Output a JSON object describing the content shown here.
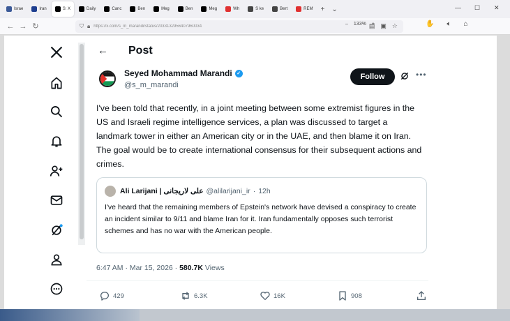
{
  "browser": {
    "tabs": [
      {
        "label": "Israe",
        "color": "#3b5998"
      },
      {
        "label": "Iran",
        "color": "#1d3d8f"
      },
      {
        "label": "S: X",
        "color": "#000000",
        "active": true
      },
      {
        "label": "Daily",
        "color": "#000000"
      },
      {
        "label": "Canc",
        "color": "#000000"
      },
      {
        "label": "Ben",
        "color": "#000000"
      },
      {
        "label": "Meg",
        "color": "#000000"
      },
      {
        "label": "Ben",
        "color": "#000000"
      },
      {
        "label": "Meg",
        "color": "#000000"
      },
      {
        "label": "Wh",
        "color": "#e03131"
      },
      {
        "label": "S ke",
        "color": "#444444"
      },
      {
        "label": "Bert",
        "color": "#444444"
      },
      {
        "label": "REM",
        "color": "#e03131"
      }
    ],
    "new_tab": "+",
    "url": "https://x.com/s_m_marandi/status/2033132956407960034",
    "zoom": "133%"
  },
  "sidebar": {
    "items": [
      "x-logo-icon",
      "home-icon",
      "search-icon",
      "notifications-icon",
      "follow-icon",
      "messages-icon",
      "grok-icon",
      "profile-icon",
      "more-icon"
    ]
  },
  "post": {
    "header_title": "Post",
    "author_name": "Seyed Mohammad Marandi",
    "author_handle": "@s_m_marandi",
    "follow_label": "Follow",
    "text": "I've been told that recently, in a joint meeting between some extremist figures in the US and Israeli regime intelligence services, a plan was discussed to target a landmark tower in either an American city or in the UAE, and then blame it on Iran. The goal would be to create international consensus for their subsequent actions and crimes.",
    "quote": {
      "name": "Ali Larijani | علی لاریجانی",
      "handle": "@alilarijani_ir",
      "dot": "·",
      "time": "12h",
      "text": "I've heard that the remaining members of Epstein's network have devised a conspiracy to create an incident similar to 9/11 and blame Iran for it. Iran fundamentally opposes such terrorist schemes and has no war with the American people."
    },
    "time": "6:47 AM",
    "date": "Mar 15, 2026",
    "sep": "·",
    "views_count": "580.7K",
    "views_label": "Views",
    "actions": {
      "replies": "429",
      "reposts": "6.3K",
      "likes": "16K",
      "bookmarks": "908"
    }
  }
}
